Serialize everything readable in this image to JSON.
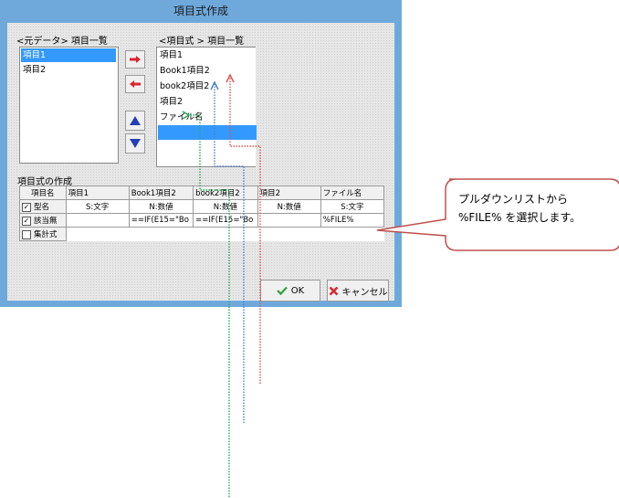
{
  "dialog": {
    "title": "項目式作成",
    "source_list": {
      "label": "<元データ> 項目一覧",
      "items": [
        "項目1",
        "項目2"
      ],
      "selected_index": 0
    },
    "target_list": {
      "label": "<項目式 > 項目一覧",
      "items": [
        "項目1",
        "Book1項目2",
        "book2項目2",
        "項目2",
        "ファイル名",
        ""
      ],
      "selected_index": 5
    },
    "buttons": {
      "add": "right-arrow-icon",
      "remove": "left-arrow-icon",
      "up": "up-triangle-icon",
      "down": "down-triangle-icon",
      "ok": "OK",
      "cancel": "キャンセル"
    },
    "formula": {
      "label": "項目式の作成",
      "corner": "項目名",
      "columns": [
        "項目1",
        "Book1項目2",
        "book2項目2",
        "項目2",
        "ファイル名"
      ],
      "rows": [
        {
          "name": "型名",
          "checked": true,
          "cells": [
            "S:文字",
            "N:数値",
            "N:数値",
            "N:数値",
            "S:文字"
          ]
        },
        {
          "name": "該当無",
          "checked": true,
          "cells": [
            "",
            "==IF(E15=\"Bo",
            "==IF(E15=\"Bo",
            "",
            "%FILE%"
          ]
        },
        {
          "name": "集計式",
          "checked": false,
          "cells": [
            "",
            "",
            "",
            "",
            ""
          ]
        }
      ],
      "checkmark": "✓"
    }
  },
  "callout": {
    "line1": "プルダウンリストから",
    "line2": "%FILE% を選択します。"
  },
  "colors": {
    "title_bar": "#6fa9dc",
    "selection": "#3399ff",
    "arrow_red": "#d9534f",
    "arrow_blue": "#4a7fc8",
    "arrow_green": "#25a55a",
    "callout_border": "#c0504d"
  }
}
